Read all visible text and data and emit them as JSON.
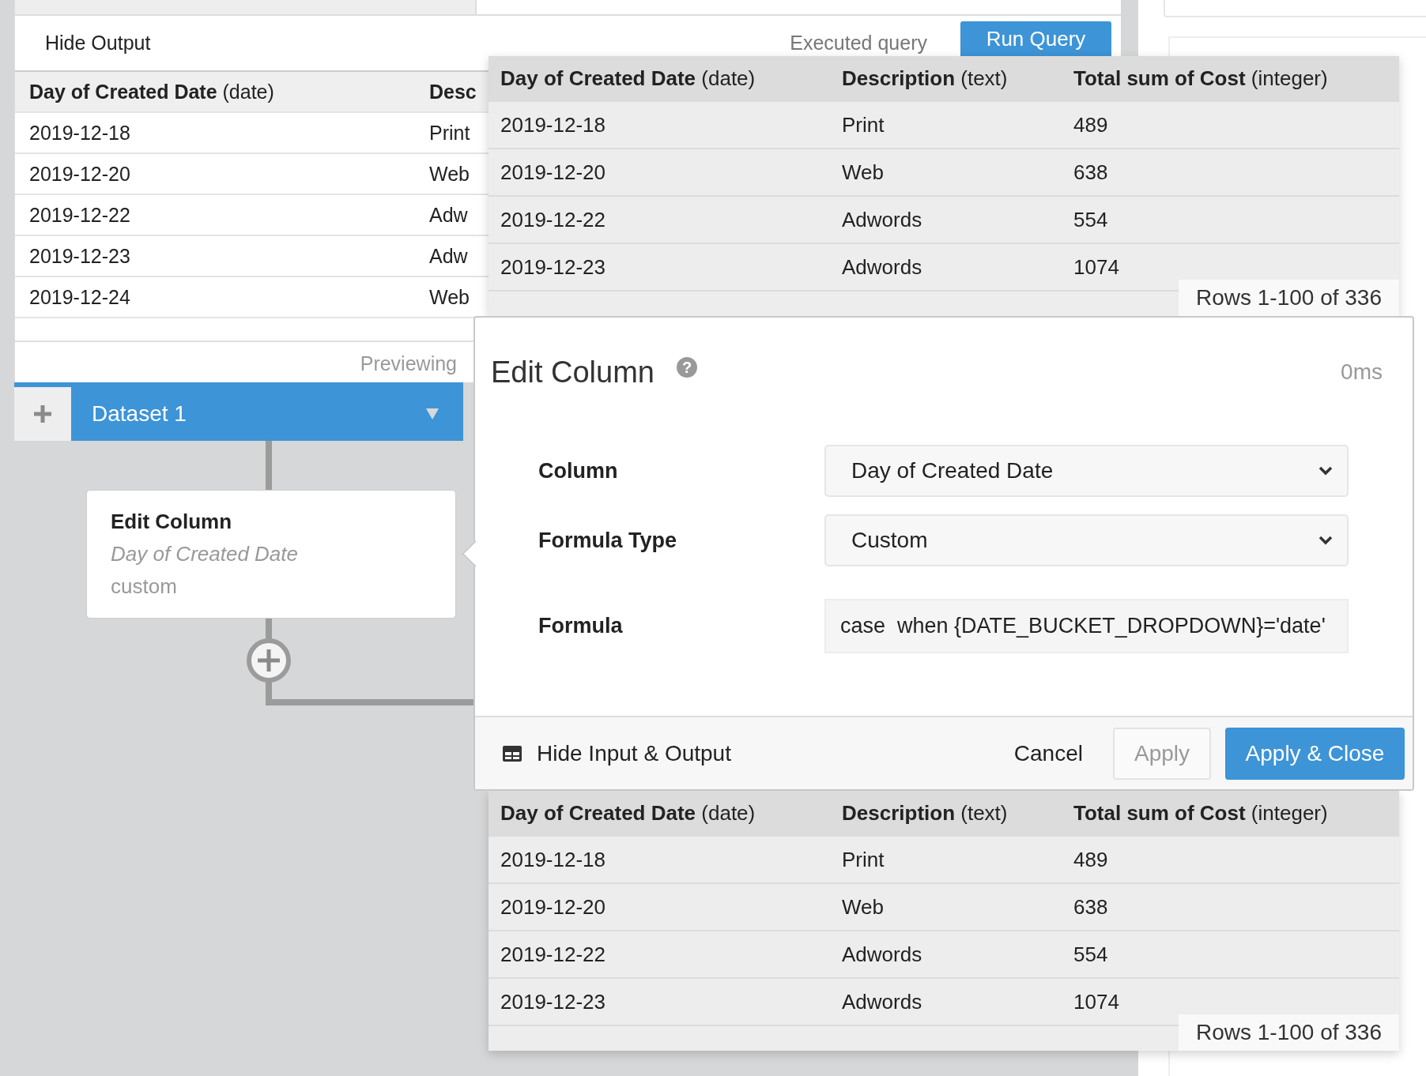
{
  "output_bar": {
    "toggle": "Hide Output",
    "status": "Executed query",
    "run_button": "Run Query"
  },
  "background_table": {
    "columns": [
      "**Day of Created Date** (date)",
      "Desc"
    ],
    "rows": [
      [
        "2019-12-18",
        "Print"
      ],
      [
        "2019-12-20",
        "Web"
      ],
      [
        "2019-12-22",
        "Adw"
      ],
      [
        "2019-12-23",
        "Adw"
      ],
      [
        "2019-12-24",
        "Web"
      ]
    ]
  },
  "preview_note": "Previewing",
  "dataset_tab": {
    "label": "Dataset 1"
  },
  "step_card": {
    "title": "Edit Column",
    "column": "Day of Created Date",
    "type": "custom"
  },
  "input_table": {
    "columns": [
      "**Day of Created Date** (date)",
      "**Description** (text)",
      "**Total sum of Cost** (integer)"
    ],
    "rows": [
      [
        "2019-12-18",
        "Print",
        "489"
      ],
      [
        "2019-12-20",
        "Web",
        "638"
      ],
      [
        "2019-12-22",
        "Adwords",
        "554"
      ],
      [
        "2019-12-23",
        "Adwords",
        "1074"
      ]
    ],
    "row_count": "Rows 1-100 of 336"
  },
  "modal": {
    "title": "Edit Column",
    "help": "?",
    "timing": "0ms",
    "fields": [
      {
        "kind": "select",
        "label": "Column",
        "value": "Day of Created Date"
      },
      {
        "kind": "select",
        "label": "Formula Type",
        "value": "Custom"
      },
      {
        "kind": "text",
        "label": "Formula",
        "value": "case  when {DATE_BUCKET_DROPDOWN}='date'"
      }
    ],
    "footer": {
      "toggle": "Hide Input & Output",
      "cancel": "Cancel",
      "apply": "Apply",
      "apply_disabled": true,
      "apply_close": "Apply & Close"
    }
  },
  "output_table": {
    "columns": [
      "**Day of Created Date** (date)",
      "**Description** (text)",
      "**Total sum of Cost** (integer)"
    ],
    "rows": [
      [
        "2019-12-18",
        "Print",
        "489"
      ],
      [
        "2019-12-20",
        "Web",
        "638"
      ],
      [
        "2019-12-22",
        "Adwords",
        "554"
      ],
      [
        "2019-12-23",
        "Adwords",
        "1074"
      ]
    ],
    "row_count": "Rows 1-100 of 336"
  }
}
